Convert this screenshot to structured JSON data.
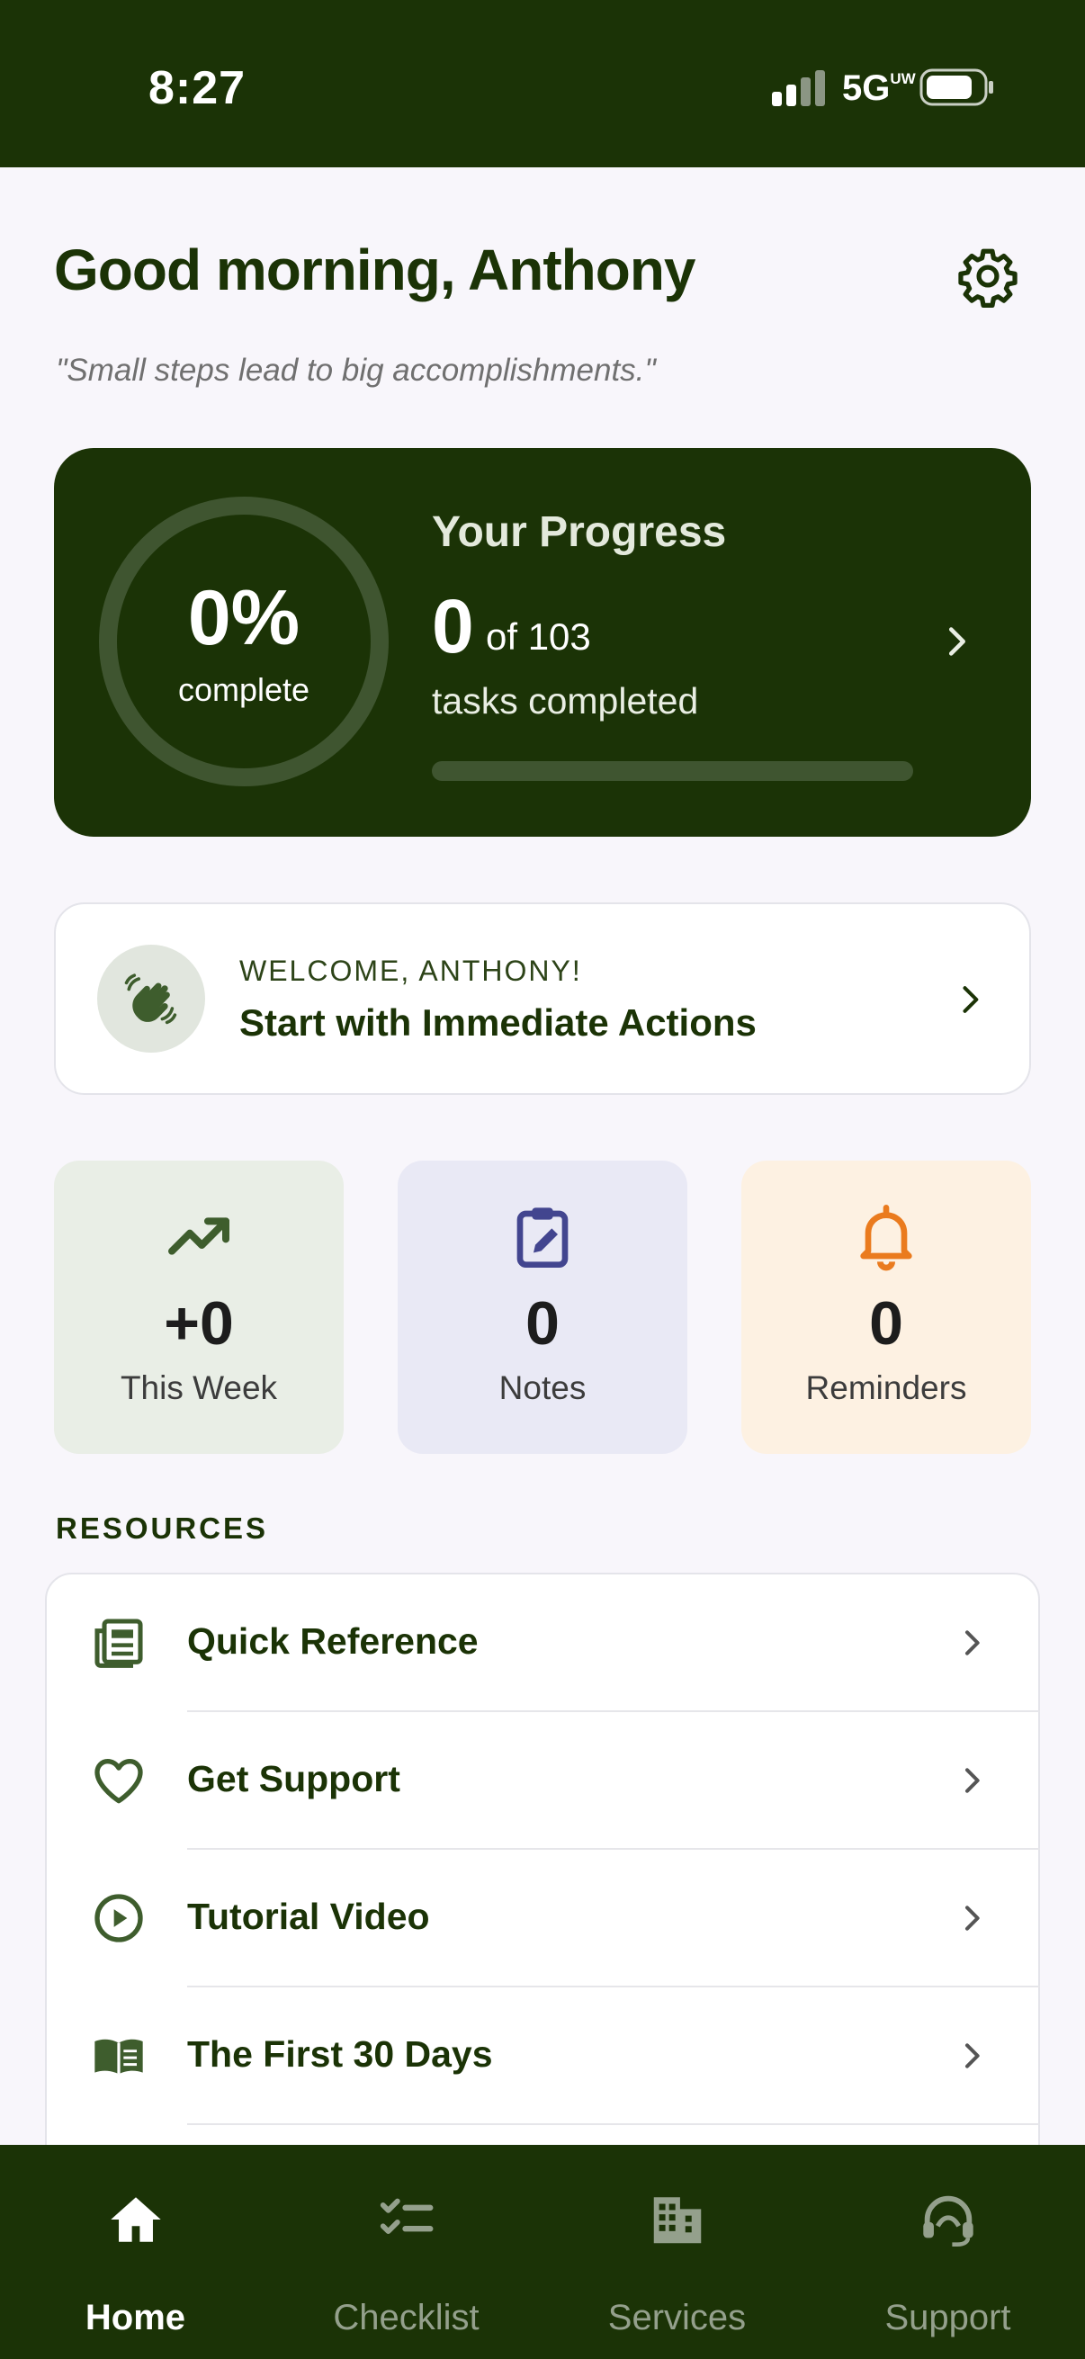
{
  "status_bar": {
    "time": "8:27",
    "network": "5G",
    "network_suffix": "UW"
  },
  "header": {
    "greeting": "Good morning, Anthony",
    "quote": "\"Small steps lead to big accomplishments.\""
  },
  "progress": {
    "percent_label": "0%",
    "complete_label": "complete",
    "title": "Your Progress",
    "completed": "0",
    "total_label": "of 103",
    "tasks_label": "tasks completed",
    "fraction": 0
  },
  "welcome": {
    "kicker": "WELCOME, ANTHONY!",
    "title": "Start with Immediate Actions"
  },
  "stats": [
    {
      "value": "+0",
      "label": "This Week",
      "icon": "trending-up-icon",
      "bg": "#e9eee6",
      "icon_color": "#3e5d2d"
    },
    {
      "value": "0",
      "label": "Notes",
      "icon": "clipboard-edit-icon",
      "bg": "#e9e9f5",
      "icon_color": "#42458f"
    },
    {
      "value": "0",
      "label": "Reminders",
      "icon": "bell-icon",
      "bg": "#fdf1e2",
      "icon_color": "#ea7b1e"
    }
  ],
  "resources": {
    "heading": "RESOURCES",
    "items": [
      {
        "label": "Quick Reference",
        "icon": "newspaper-icon"
      },
      {
        "label": "Get Support",
        "icon": "heart-icon"
      },
      {
        "label": "Tutorial Video",
        "icon": "play-circle-icon"
      },
      {
        "label": "The First 30 Days",
        "icon": "open-book-icon"
      }
    ]
  },
  "tabs": [
    {
      "label": "Home",
      "icon": "home-icon",
      "active": true
    },
    {
      "label": "Checklist",
      "icon": "checklist-icon",
      "active": false
    },
    {
      "label": "Services",
      "icon": "building-icon",
      "active": false
    },
    {
      "label": "Support",
      "icon": "headset-icon",
      "active": false
    }
  ],
  "colors": {
    "brand_dark": "#1b3306",
    "page_bg": "#f8f6fb",
    "tab_inactive": "#94a08c"
  }
}
